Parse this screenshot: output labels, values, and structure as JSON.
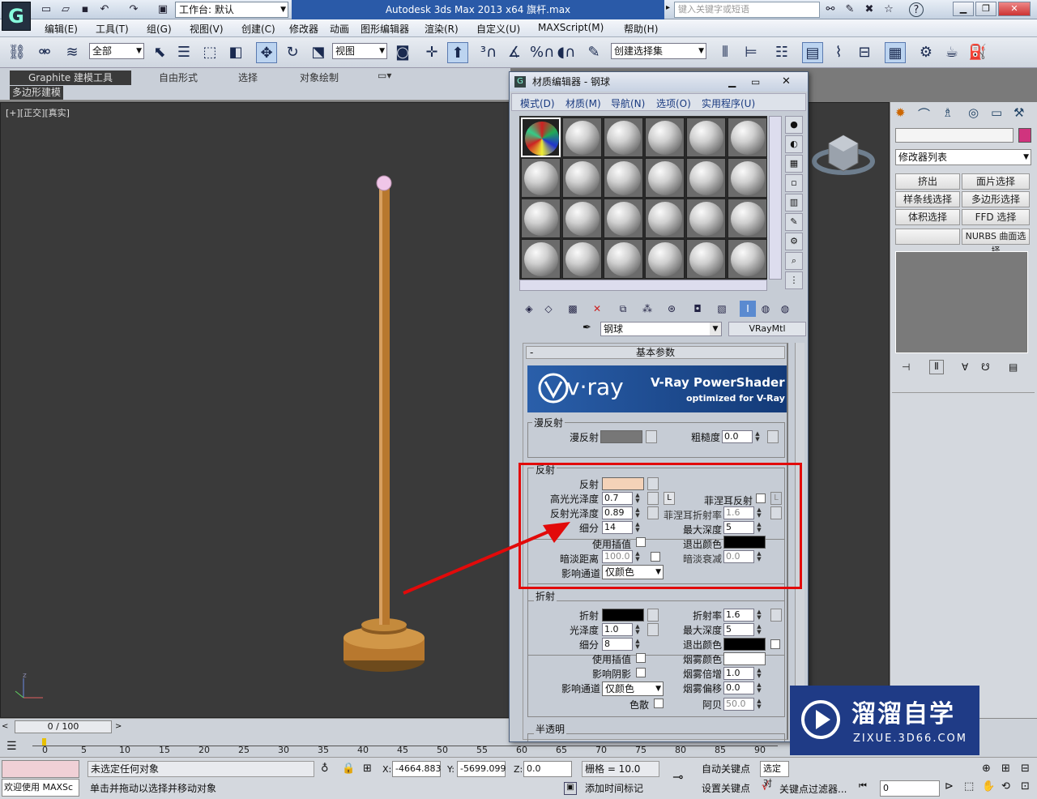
{
  "app": {
    "title": "Autodesk 3ds Max  2013 x64    旗杆.max",
    "workspace": "工作台: 默认",
    "search_placeholder": "键入关键字或短语"
  },
  "menu": [
    "编辑(E)",
    "工具(T)",
    "组(G)",
    "视图(V)",
    "创建(C)",
    "修改器",
    "动画",
    "图形编辑器",
    "渲染(R)",
    "自定义(U)",
    "MAXScript(M)",
    "帮助(H)"
  ],
  "toolbar": {
    "filter": "全部",
    "ref_coord": "视图",
    "selection_set": "创建选择集"
  },
  "ribbon": {
    "tabs": [
      "Graphite 建模工具",
      "自由形式",
      "选择",
      "对象绘制"
    ],
    "sub": "多边形建模"
  },
  "viewport": {
    "label": "[+][正交][真实]"
  },
  "command_panel": {
    "modifier_list": "修改器列表",
    "buttons": [
      "挤出",
      "面片选择",
      "样条线选择",
      "多边形选择",
      "体积选择",
      "FFD 选择",
      "",
      "NURBS 曲面选择"
    ]
  },
  "timeline": {
    "frame": "0 / 100",
    "ticks": [
      "0",
      "5",
      "10",
      "15",
      "20",
      "25",
      "30",
      "35",
      "40",
      "45",
      "50",
      "55",
      "60",
      "65",
      "70",
      "75",
      "80",
      "85",
      "90"
    ]
  },
  "status": {
    "selection": "未选定任何对象",
    "prompt": "单击并拖动以选择并移动对象",
    "welcome": "欢迎使用 MAXSc",
    "x": "-4664.883",
    "y": "-5699.099",
    "z": "0.0",
    "grid": "栅格 = 10.0",
    "add_time_tag": "添加时间标记",
    "auto_key": "自动关键点",
    "set_key": "设置关键点",
    "selected": "选定对",
    "key_filter": "关键点过滤器...",
    "frame_field": "0"
  },
  "material_editor": {
    "title": "材质编辑器 - 钢球",
    "menu": [
      "模式(D)",
      "材质(M)",
      "导航(N)",
      "选项(O)",
      "实用程序(U)"
    ],
    "material_name": "钢球",
    "material_type": "VRayMtl",
    "rollout_title": "基本参数",
    "banner": {
      "brand": "v·ray",
      "product": "V-Ray PowerShader",
      "tagline": "optimized for V-Ray"
    },
    "diffuse": {
      "group": "漫反射",
      "label": "漫反射",
      "roughness_label": "粗糙度",
      "roughness": "0.0"
    },
    "reflection": {
      "group": "反射",
      "label": "反射",
      "hilight_gloss_label": "高光光泽度",
      "hilight_gloss": "0.7",
      "l_label": "L",
      "fresnel_label": "菲涅耳反射",
      "refl_gloss_label": "反射光泽度",
      "refl_gloss": "0.89",
      "fresnel_ior_label": "菲涅耳折射率",
      "fresnel_ior": "1.6",
      "subdivs_label": "细分",
      "subdivs": "14",
      "max_depth_label": "最大深度",
      "max_depth": "5",
      "use_interp_label": "使用插值",
      "exit_color_label": "退出颜色",
      "dim_dist_label": "暗淡距离",
      "dim_dist": "100.0",
      "dim_falloff_label": "暗淡衰减",
      "dim_falloff": "0.0",
      "affect_channels_label": "影响通道",
      "affect_channels": "仅颜色"
    },
    "refraction": {
      "group": "折射",
      "label": "折射",
      "ior_label": "折射率",
      "ior": "1.6",
      "gloss_label": "光泽度",
      "gloss": "1.0",
      "max_depth_label": "最大深度",
      "max_depth": "5",
      "subdivs_label": "细分",
      "subdivs": "8",
      "exit_color_label": "退出颜色",
      "use_interp_label": "使用插值",
      "fog_color_label": "烟雾颜色",
      "affect_shadows_label": "影响阴影",
      "fog_mult_label": "烟雾倍增",
      "fog_mult": "1.0",
      "affect_channels_label": "影响通道",
      "affect_channels": "仅颜色",
      "fog_bias_label": "烟雾偏移",
      "fog_bias": "0.0",
      "dispersion_label": "色散",
      "abbe_label": "阿贝",
      "abbe": "50.0"
    },
    "translucency": {
      "group": "半透明"
    }
  },
  "watermark": {
    "title": "溜溜自学",
    "url": "ZIXUE.3D66.COM"
  },
  "colors": {
    "reflect": "#f4d2b8",
    "pole": "#b8782e",
    "viewport_bg": "#3a3a3a",
    "annotation": "#e20a0a"
  }
}
